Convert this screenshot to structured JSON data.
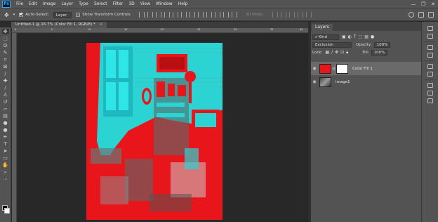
{
  "menu": [
    "File",
    "Edit",
    "Image",
    "Layer",
    "Type",
    "Select",
    "Filter",
    "3D",
    "View",
    "Window",
    "Help"
  ],
  "app_logo": "Ps",
  "window_controls": [
    "—",
    "❐",
    "✕"
  ],
  "options_bar": {
    "auto_select_label": "Auto-Select:",
    "auto_select_value": "Layer",
    "transform_label": "Show Transform Controls",
    "mode_3d_label": "3D Mode:"
  },
  "document_tab": {
    "title": "Untitled-1 @ 16.7% (Color Fill 1, RGB/8) *",
    "close": "×"
  },
  "ruler": {
    "ticks": [
      "0",
      "5",
      "10",
      "15",
      "20",
      "25",
      "30",
      "35",
      "40"
    ]
  },
  "layers_panel": {
    "tab": "Layers",
    "kind_label": "Kind",
    "blend_mode": "Exclusion",
    "opacity_label": "Opacity:",
    "opacity_value": "100%",
    "lock_label": "Lock:",
    "fill_label": "Fill:",
    "fill_value": "100%",
    "layers": [
      {
        "name": "Color Fill 1",
        "selected": true
      },
      {
        "name": "image1",
        "selected": false
      }
    ]
  },
  "colors": {
    "fill_red": "#e8161a",
    "cyan": "#2ad2d2",
    "accent": "#31a8ff"
  },
  "icons": [
    "move-icon",
    "marquee-icon",
    "lasso-icon",
    "quick-select-icon",
    "crop-icon",
    "frame-icon",
    "eyedropper-icon",
    "healing-icon",
    "brush-icon",
    "stamp-icon",
    "history-brush-icon",
    "eraser-icon",
    "gradient-icon",
    "blur-icon",
    "dodge-icon",
    "pen-icon",
    "type-icon",
    "path-select-icon",
    "shape-icon",
    "hand-icon",
    "zoom-icon",
    "more-icon"
  ]
}
